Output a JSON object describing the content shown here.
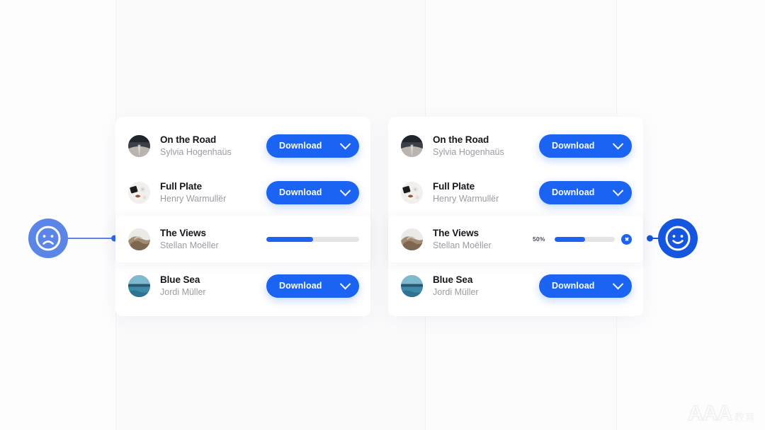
{
  "background": {
    "page_color": "#ffffff",
    "panel_tint": "#fbfbfc"
  },
  "theme": {
    "accent_blue": "#1b63f3",
    "accent_blue_dark": "#1556e0",
    "accent_blue_light": "#5b86e8",
    "track_gray": "#e4e4e7",
    "title_color": "#15171c",
    "subtitle_color": "#9a9ca3"
  },
  "markers": {
    "sad": {
      "name": "sad-face",
      "glyph": "frown",
      "color": "#5b86e8"
    },
    "happy": {
      "name": "happy-face",
      "glyph": "smile",
      "color": "#1556e0"
    }
  },
  "panels": [
    {
      "id": "before",
      "rows": [
        {
          "title": "On the Road",
          "artist": "Sylvia Hogenhaüs",
          "avatar": "road",
          "action": "download",
          "button_label": "Download"
        },
        {
          "title": "Full Plate",
          "artist": "Henry Warmullër",
          "avatar": "plate",
          "action": "download",
          "button_label": "Download"
        },
        {
          "title": "The Views",
          "artist": "Stellan Moëller",
          "avatar": "views",
          "action": "progress",
          "progress_value": 50,
          "progress_label": "",
          "show_percent": false,
          "show_cancel": false
        },
        {
          "title": "Blue Sea",
          "artist": "Jordi Müller",
          "avatar": "sea",
          "action": "download",
          "button_label": "Download"
        }
      ]
    },
    {
      "id": "after",
      "rows": [
        {
          "title": "On the Road",
          "artist": "Sylvia Hogenhaüs",
          "avatar": "road",
          "action": "download",
          "button_label": "Download"
        },
        {
          "title": "Full Plate",
          "artist": "Henry Warmullër",
          "avatar": "plate",
          "action": "download",
          "button_label": "Download"
        },
        {
          "title": "The Views",
          "artist": "Stellan Moëller",
          "avatar": "views",
          "action": "progress",
          "progress_value": 50,
          "progress_label": "50%",
          "show_percent": true,
          "show_cancel": true
        },
        {
          "title": "Blue Sea",
          "artist": "Jordi Müller",
          "avatar": "sea",
          "action": "download",
          "button_label": "Download"
        }
      ]
    }
  ],
  "watermark": {
    "main": "AAA",
    "sub": "教育"
  }
}
